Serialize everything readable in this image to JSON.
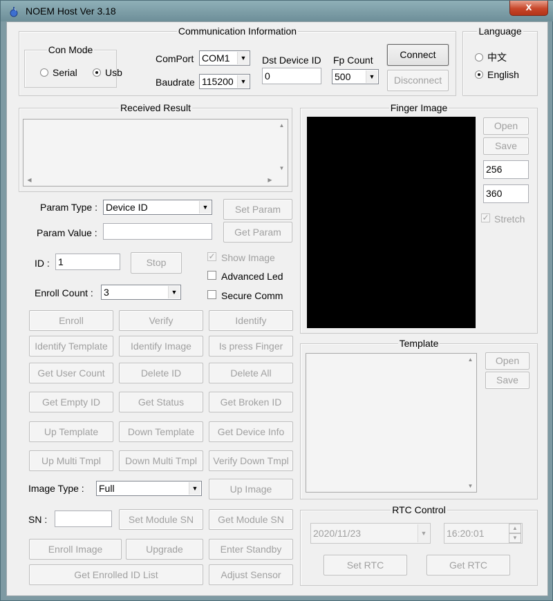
{
  "window": {
    "title": "NOEM Host Ver 3.18",
    "close_glyph": "x"
  },
  "communication": {
    "title": "Communication Information",
    "con_mode": {
      "title": "Con Mode",
      "options": [
        "Serial",
        "Usb"
      ],
      "selected": "Usb"
    },
    "comport_label": "ComPort",
    "comport_value": "COM1",
    "baudrate_label": "Baudrate",
    "baudrate_value": "115200",
    "dst_label": "Dst Device ID",
    "dst_value": "0",
    "fp_label": "Fp Count",
    "fp_value": "500",
    "connect": "Connect",
    "disconnect": "Disconnect"
  },
  "language": {
    "title": "Language",
    "options": [
      "中文",
      "English"
    ],
    "selected": "English"
  },
  "received": {
    "title": "Received Result"
  },
  "finger_image": {
    "title": "Finger Image",
    "open": "Open",
    "save": "Save",
    "width": "256",
    "height": "360",
    "stretch": "Stretch",
    "stretch_checked": true
  },
  "params": {
    "type_label": "Param Type :",
    "type_value": "Device ID",
    "value_label": "Param Value :",
    "value_value": "",
    "set": "Set Param",
    "get": "Get Param"
  },
  "id": {
    "label": "ID :",
    "value": "1",
    "stop": "Stop"
  },
  "enroll_count": {
    "label": "Enroll Count :",
    "value": "3"
  },
  "options": [
    {
      "label": "Show Image",
      "checked": true,
      "disabled": true
    },
    {
      "label": "Advanced Led",
      "checked": false,
      "disabled": false
    },
    {
      "label": "Secure Comm",
      "checked": false,
      "disabled": false
    }
  ],
  "buttons": {
    "enroll": "Enroll",
    "verify": "Verify",
    "identify": "Identify",
    "identify_template": "Identify Template",
    "identify_image": "Identify Image",
    "is_press_finger": "Is press Finger",
    "get_user_count": "Get User Count",
    "delete_id": "Delete ID",
    "delete_all": "Delete All",
    "get_empty_id": "Get Empty ID",
    "get_status": "Get Status",
    "get_broken_id": "Get Broken ID",
    "up_template": "Up Template",
    "down_template": "Down Template",
    "get_device_info": "Get Device Info",
    "up_multi_tmpl": "Up Multi Tmpl",
    "down_multi_tmpl": "Down Multi Tmpl",
    "verify_down_tmpl": "Verify Down Tmpl",
    "up_image": "Up Image",
    "set_module_sn": "Set Module SN",
    "get_module_sn": "Get Module SN",
    "enroll_image": "Enroll Image",
    "upgrade": "Upgrade",
    "enter_standby": "Enter Standby",
    "get_enrolled_id_list": "Get Enrolled ID List",
    "adjust_sensor": "Adjust Sensor"
  },
  "image_type": {
    "label": "Image Type :",
    "value": "Full"
  },
  "sn": {
    "label": "SN :",
    "value": ""
  },
  "template": {
    "title": "Template",
    "open": "Open",
    "save": "Save"
  },
  "rtc": {
    "title": "RTC Control",
    "date": "2020/11/23",
    "time": "16:20:01",
    "set": "Set RTC",
    "get": "Get RTC"
  }
}
